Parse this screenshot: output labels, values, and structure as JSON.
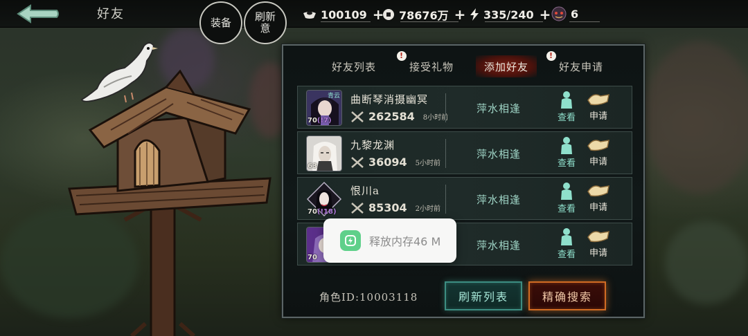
{
  "header": {
    "title": "好友",
    "buttons": [
      {
        "label": "装备"
      },
      {
        "label": "刷新意"
      }
    ],
    "resources": [
      {
        "icon": "ingot-icon",
        "value": "100109"
      },
      {
        "icon": "coin-icon",
        "value": "78676万"
      },
      {
        "icon": "lightning-icon",
        "value": "335/240"
      },
      {
        "icon": "demon-mask-icon",
        "value": "6"
      }
    ]
  },
  "panel": {
    "tabs": [
      {
        "label": "好友列表",
        "badge": ""
      },
      {
        "label": "接受礼物",
        "badge": "!"
      },
      {
        "label": "添加好友",
        "badge": ""
      },
      {
        "label": "好友申请",
        "badge": "!"
      }
    ],
    "active_tab": "添加好友",
    "players": [
      {
        "name": "曲断琴消摄幽冥",
        "level": "70",
        "level_extra": "(!7)",
        "power": "262584",
        "time": "8小时前",
        "status": "萍水相逢",
        "view_label": "查看",
        "apply_label": "申请"
      },
      {
        "name": "九黎龙渊",
        "level": "63",
        "level_extra": "",
        "power": "36094",
        "time": "5小时前",
        "status": "萍水相逢",
        "view_label": "查看",
        "apply_label": "申请"
      },
      {
        "name": "恨川a",
        "level": "70",
        "level_extra": "(!18)",
        "power": "85304",
        "time": "2小时前",
        "status": "萍水相逢",
        "view_label": "查看",
        "apply_label": "申请"
      },
      {
        "name": "",
        "level": "70",
        "level_extra": "",
        "power": "",
        "time": "",
        "status": "萍水相逢",
        "view_label": "查看",
        "apply_label": "申请"
      }
    ],
    "role_id": "角色ID:10003118",
    "refresh_label": "刷新列表",
    "search_label": "精确搜索"
  },
  "toast": {
    "text": "释放内存46 M"
  },
  "colors": {
    "accent_red": "#d16b23",
    "accent_teal": "#3c8d82",
    "status_text": "#9fd5c6"
  }
}
